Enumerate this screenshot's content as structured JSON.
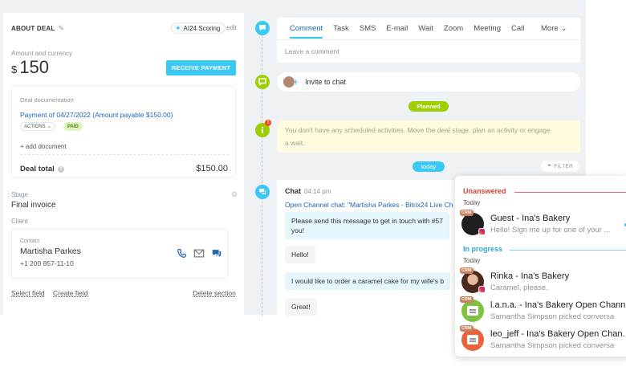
{
  "deal": {
    "title": "ABOUT DEAL",
    "ai_chip": "AI24 Scoring",
    "edit": "edit",
    "amount_label": "Amount and currency",
    "currency_symbol": "$",
    "amount": "150",
    "receive_payment": "RECEIVE PAYMENT",
    "doc_label": "Deal documentation",
    "payment_link": "Payment of 04/27/2022 (Amount payable $150.00)",
    "actions": "ACTIONS",
    "paid": "PAID",
    "add_document": "+ add document",
    "deal_total_label": "Deal total",
    "deal_total_value": "$150.00",
    "stage_label": "Stage",
    "stage_value": "Final invoice",
    "client_label": "Client",
    "contact_label": "Contact",
    "contact_name": "Martisha Parkes",
    "contact_phone": "+1 200 857-11-10",
    "select_field": "Select field",
    "create_field": "Create field",
    "delete_section": "Delete section"
  },
  "composer": {
    "tabs": [
      "Comment",
      "Task",
      "SMS",
      "E-mail",
      "Wait",
      "Zoom",
      "Meeting",
      "Call"
    ],
    "more": "More",
    "placeholder": "Leave a comment"
  },
  "timeline": {
    "invite": "Invite to chat",
    "planned": "Planned",
    "badge": "1",
    "warning_line1": "You don't have any scheduled activities. Move the deal stage, plan an activity or engage",
    "warning_line2": "a wait.",
    "today": "today",
    "filter": "FILTER"
  },
  "chat": {
    "title": "Chat",
    "time": "04:14 pm",
    "channel": "Open Channel chat: \"Martisha Parkes - Bitrix24 Live Ch",
    "messages": [
      {
        "dir": "in",
        "line1": "Please send this message to get in touch with #57",
        "line2": "you!"
      },
      {
        "dir": "out",
        "line1": "Hello!"
      },
      {
        "dir": "in",
        "line1": "I would like to order a caramel cake for my wife's b"
      },
      {
        "dir": "out",
        "line1": "Great!"
      }
    ]
  },
  "popup": {
    "unanswered": "Unanswered",
    "in_progress": "In progress",
    "today1": "Today",
    "today2": "Today",
    "crm_tag": "CRM",
    "items": [
      {
        "name": "Guest - Ina's Bakery",
        "sub": "Hello! Sign me up for one of your ..."
      },
      {
        "name": "Rinka - Ina's Bakery",
        "sub": "Caramel, please."
      },
      {
        "name": "l.a.n.a. - Ina's Bakery Open Chann",
        "sub": "Samantha Simpson picked conversa"
      },
      {
        "name": "leo_jeff - Ina's Bakery Open Chan.",
        "sub": "Samantha Simpson picked conversa"
      }
    ]
  }
}
